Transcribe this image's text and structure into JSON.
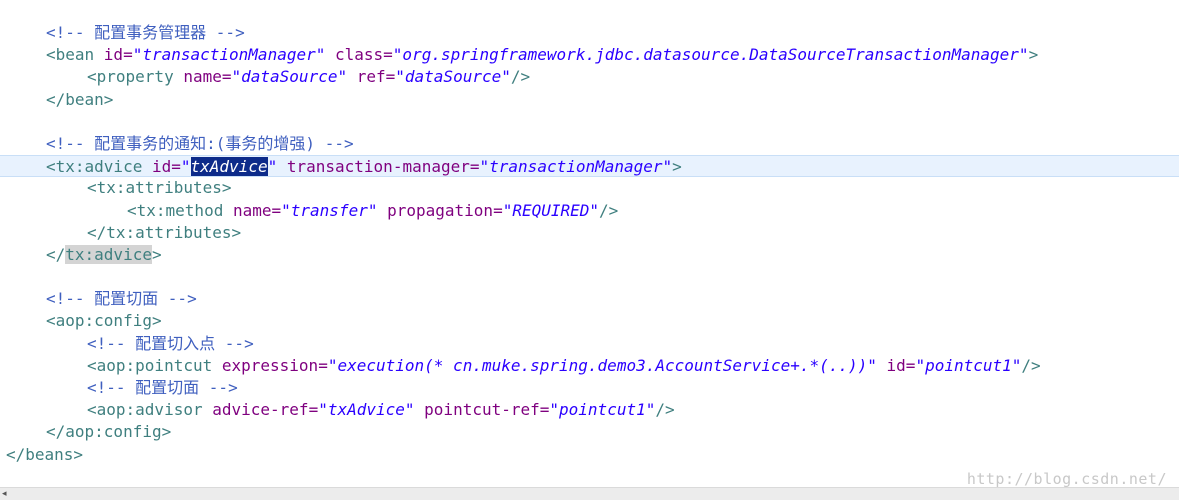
{
  "lines": [
    {
      "indent": "indent-0",
      "parts": [
        {
          "c": "comment",
          "t": "<!-- 配置事务管理器 -->"
        }
      ]
    },
    {
      "indent": "indent-0",
      "parts": [
        {
          "c": "tag",
          "t": "<bean "
        },
        {
          "c": "attr",
          "t": "id="
        },
        {
          "c": "val",
          "t": "\"transactionManager\""
        },
        {
          "c": "attr",
          "t": " class="
        },
        {
          "c": "val",
          "t": "\"org.springframework.jdbc.datasource.DataSourceTransactionManager\""
        },
        {
          "c": "tag",
          "t": ">"
        }
      ]
    },
    {
      "indent": "indent-1",
      "parts": [
        {
          "c": "tag",
          "t": "<property "
        },
        {
          "c": "attr",
          "t": "name="
        },
        {
          "c": "val",
          "t": "\"dataSource\""
        },
        {
          "c": "attr",
          "t": " ref="
        },
        {
          "c": "val",
          "t": "\"dataSource\""
        },
        {
          "c": "tag",
          "t": "/>"
        }
      ]
    },
    {
      "indent": "indent-0",
      "parts": [
        {
          "c": "tag",
          "t": "</bean>"
        }
      ]
    },
    {
      "indent": "indent-0",
      "parts": []
    },
    {
      "indent": "indent-0",
      "parts": [
        {
          "c": "comment",
          "t": "<!-- 配置事务的通知:(事务的增强) -->"
        }
      ]
    },
    {
      "indent": "indent-0",
      "current": true,
      "parts": [
        {
          "c": "tag",
          "t": "<tx:advice "
        },
        {
          "c": "attr",
          "t": "id="
        },
        {
          "c": "val",
          "t": "\""
        },
        {
          "c": "sel",
          "t": "txAdvice"
        },
        {
          "c": "val",
          "t": "\""
        },
        {
          "c": "attr",
          "t": " transaction-manager="
        },
        {
          "c": "val",
          "t": "\"transactionManager\""
        },
        {
          "c": "tag",
          "t": ">"
        }
      ]
    },
    {
      "indent": "indent-1",
      "parts": [
        {
          "c": "tag",
          "t": "<tx:attributes>"
        }
      ]
    },
    {
      "indent": "indent-2",
      "parts": [
        {
          "c": "tag",
          "t": "<tx:method "
        },
        {
          "c": "attr",
          "t": "name="
        },
        {
          "c": "val",
          "t": "\"transfer\""
        },
        {
          "c": "attr",
          "t": " propagation="
        },
        {
          "c": "val",
          "t": "\"REQUIRED\""
        },
        {
          "c": "tag",
          "t": "/>"
        }
      ]
    },
    {
      "indent": "indent-1",
      "parts": [
        {
          "c": "tag",
          "t": "</tx:attributes>"
        }
      ]
    },
    {
      "indent": "indent-0",
      "parts": [
        {
          "c": "tag",
          "t": "</"
        },
        {
          "c": "tag match",
          "t": "tx:advice"
        },
        {
          "c": "tag",
          "t": ">"
        }
      ]
    },
    {
      "indent": "indent-0",
      "parts": []
    },
    {
      "indent": "indent-0",
      "parts": [
        {
          "c": "comment",
          "t": "<!-- 配置切面 -->"
        }
      ]
    },
    {
      "indent": "indent-0",
      "parts": [
        {
          "c": "tag",
          "t": "<aop:config>"
        }
      ]
    },
    {
      "indent": "indent-1",
      "parts": [
        {
          "c": "comment",
          "t": "<!-- 配置切入点 -->"
        }
      ]
    },
    {
      "indent": "indent-1",
      "parts": [
        {
          "c": "tag",
          "t": "<aop:pointcut "
        },
        {
          "c": "attr",
          "t": "expression="
        },
        {
          "c": "val",
          "t": "\"execution(* cn.muke.spring.demo3.AccountService+.*(..))\""
        },
        {
          "c": "attr",
          "t": " id="
        },
        {
          "c": "val",
          "t": "\"pointcut1\""
        },
        {
          "c": "tag",
          "t": "/>"
        }
      ]
    },
    {
      "indent": "indent-1",
      "parts": [
        {
          "c": "comment",
          "t": "<!-- 配置切面 -->"
        }
      ]
    },
    {
      "indent": "indent-1",
      "parts": [
        {
          "c": "tag",
          "t": "<aop:advisor "
        },
        {
          "c": "attr",
          "t": "advice-ref="
        },
        {
          "c": "val",
          "t": "\"txAdvice\""
        },
        {
          "c": "attr",
          "t": " pointcut-ref="
        },
        {
          "c": "val",
          "t": "\"pointcut1\""
        },
        {
          "c": "tag",
          "t": "/>"
        }
      ]
    },
    {
      "indent": "indent-0",
      "parts": [
        {
          "c": "tag",
          "t": "</aop:config>"
        }
      ]
    },
    {
      "indent": "indent-root",
      "parts": [
        {
          "c": "tag",
          "t": "</beans>"
        }
      ]
    }
  ],
  "watermark": "http://blog.csdn.net/",
  "scrollbar_arrow_icon": "◂"
}
